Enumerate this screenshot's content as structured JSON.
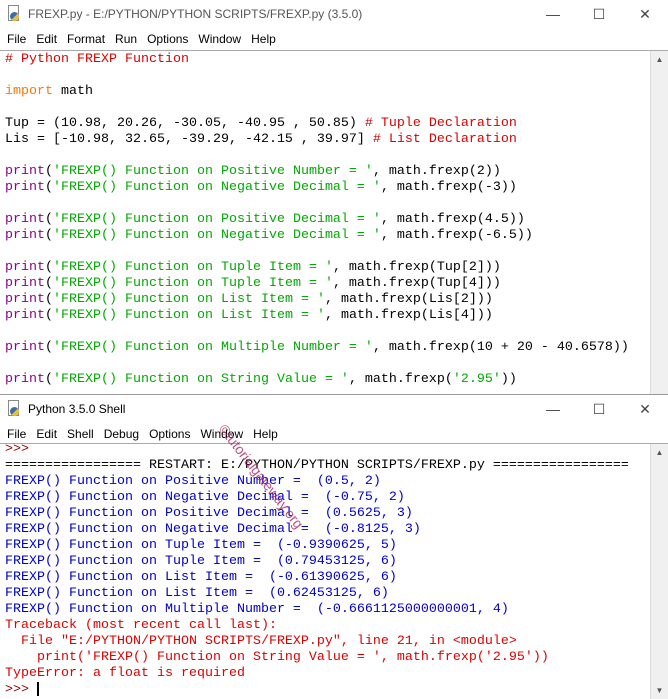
{
  "editor": {
    "title": "FREXP.py - E:/PYTHON/PYTHON SCRIPTS/FREXP.py (3.5.0)",
    "menu": [
      "File",
      "Edit",
      "Format",
      "Run",
      "Options",
      "Window",
      "Help"
    ],
    "lines": [
      [
        [
          "# Python FREXP Function",
          "#dd0000"
        ]
      ],
      [],
      [
        [
          "import",
          "#ff7700"
        ],
        [
          " math",
          "#000000"
        ]
      ],
      [],
      [
        [
          "Tup = (10.98, 20.26, -30.05, -40.95 , 50.85) ",
          "#000000"
        ],
        [
          "# Tuple Declaration",
          "#dd0000"
        ]
      ],
      [
        [
          "Lis = [-10.98, 32.65, -39.29, -42.15 , 39.97] ",
          "#000000"
        ],
        [
          "# List Declaration",
          "#dd0000"
        ]
      ],
      [],
      [
        [
          "print",
          "#900090"
        ],
        [
          "(",
          "#000000"
        ],
        [
          "'FREXP() Function on Positive Number = '",
          "#00aa00"
        ],
        [
          ", math.frexp(2))",
          "#000000"
        ]
      ],
      [
        [
          "print",
          "#900090"
        ],
        [
          "(",
          "#000000"
        ],
        [
          "'FREXP() Function on Negative Decimal = '",
          "#00aa00"
        ],
        [
          ", math.frexp(-3))",
          "#000000"
        ]
      ],
      [],
      [
        [
          "print",
          "#900090"
        ],
        [
          "(",
          "#000000"
        ],
        [
          "'FREXP() Function on Positive Decimal = '",
          "#00aa00"
        ],
        [
          ", math.frexp(4.5))",
          "#000000"
        ]
      ],
      [
        [
          "print",
          "#900090"
        ],
        [
          "(",
          "#000000"
        ],
        [
          "'FREXP() Function on Negative Decimal = '",
          "#00aa00"
        ],
        [
          ", math.frexp(-6.5))",
          "#000000"
        ]
      ],
      [],
      [
        [
          "print",
          "#900090"
        ],
        [
          "(",
          "#000000"
        ],
        [
          "'FREXP() Function on Tuple Item = '",
          "#00aa00"
        ],
        [
          ", math.frexp(Tup[2]))",
          "#000000"
        ]
      ],
      [
        [
          "print",
          "#900090"
        ],
        [
          "(",
          "#000000"
        ],
        [
          "'FREXP() Function on Tuple Item = '",
          "#00aa00"
        ],
        [
          ", math.frexp(Tup[4]))",
          "#000000"
        ]
      ],
      [
        [
          "print",
          "#900090"
        ],
        [
          "(",
          "#000000"
        ],
        [
          "'FREXP() Function on List Item = '",
          "#00aa00"
        ],
        [
          ", math.frexp(Lis[2]))",
          "#000000"
        ]
      ],
      [
        [
          "print",
          "#900090"
        ],
        [
          "(",
          "#000000"
        ],
        [
          "'FREXP() Function on List Item = '",
          "#00aa00"
        ],
        [
          ", math.frexp(Lis[4]))",
          "#000000"
        ]
      ],
      [],
      [
        [
          "print",
          "#900090"
        ],
        [
          "(",
          "#000000"
        ],
        [
          "'FREXP() Function on Multiple Number = '",
          "#00aa00"
        ],
        [
          ", math.frexp(10 + 20 - 40.6578))",
          "#000000"
        ]
      ],
      [],
      [
        [
          "print",
          "#900090"
        ],
        [
          "(",
          "#000000"
        ],
        [
          "'FREXP() Function on String Value = '",
          "#00aa00"
        ],
        [
          ", math.frexp(",
          "#000000"
        ],
        [
          "'2.95'",
          "#00aa00"
        ],
        [
          "))",
          "#000000"
        ]
      ]
    ]
  },
  "shell": {
    "title": "Python 3.5.0 Shell",
    "menu": [
      "File",
      "Edit",
      "Shell",
      "Debug",
      "Options",
      "Window",
      "Help"
    ],
    "lines": [
      [
        [
          ">>>",
          "#990000"
        ]
      ],
      [
        [
          "================= RESTART: E:/PYTHON/PYTHON SCRIPTS/FREXP.py =================",
          "#000000"
        ]
      ],
      [
        [
          "FREXP() Function on Positive Number =  (0.5, 2)",
          "#0000cc"
        ]
      ],
      [
        [
          "FREXP() Function on Negative Decimal =  (-0.75, 2)",
          "#0000cc"
        ]
      ],
      [
        [
          "FREXP() Function on Positive Decimal =  (0.5625, 3)",
          "#0000cc"
        ]
      ],
      [
        [
          "FREXP() Function on Negative Decimal =  (-0.8125, 3)",
          "#0000cc"
        ]
      ],
      [
        [
          "FREXP() Function on Tuple Item =  (-0.9390625, 5)",
          "#0000cc"
        ]
      ],
      [
        [
          "FREXP() Function on Tuple Item =  (0.79453125, 6)",
          "#0000cc"
        ]
      ],
      [
        [
          "FREXP() Function on List Item =  (-0.61390625, 6)",
          "#0000cc"
        ]
      ],
      [
        [
          "FREXP() Function on List Item =  (0.62453125, 6)",
          "#0000cc"
        ]
      ],
      [
        [
          "FREXP() Function on Multiple Number =  (-0.6661125000000001, 4)",
          "#0000cc"
        ]
      ],
      [
        [
          "Traceback (most recent call last):",
          "#dd0000"
        ]
      ],
      [
        [
          "  File \"E:/PYTHON/PYTHON SCRIPTS/FREXP.py\", line 21, in <module>",
          "#dd0000"
        ]
      ],
      [
        [
          "    print('FREXP() Function on String Value = ', math.frexp('2.95'))",
          "#dd0000"
        ]
      ],
      [
        [
          "TypeError: a float is required",
          "#dd0000"
        ]
      ],
      [
        [
          ">>> ",
          "#990000"
        ]
      ]
    ]
  },
  "watermark": "©tutorialgateway.org"
}
